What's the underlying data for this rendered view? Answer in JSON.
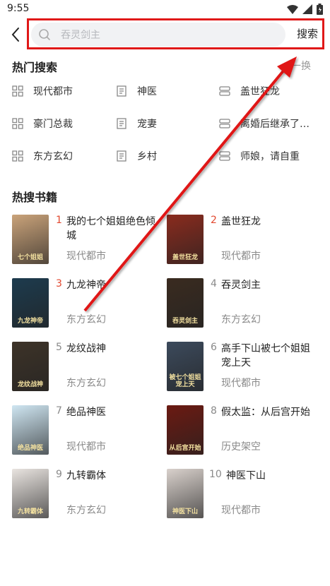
{
  "status_bar": {
    "time": "9:55"
  },
  "search": {
    "placeholder": "吞灵剑主",
    "button_label": "搜索"
  },
  "hot_search": {
    "title": "热门搜索",
    "refresh_label": "一换",
    "tags": [
      "现代都市",
      "神医",
      "盖世狂龙",
      "豪门总裁",
      "宠妻",
      "离婚后继承了…",
      "东方玄幻",
      "乡村",
      "师娘，请自重"
    ]
  },
  "hot_books": {
    "title": "热搜书籍",
    "items": [
      {
        "rank": "1",
        "title": "我的七个姐姐绝色倾城",
        "category": "现代都市",
        "cover_color": "#caa37a",
        "cover_text": "七个姐姐"
      },
      {
        "rank": "2",
        "title": "盖世狂龙",
        "category": "现代都市",
        "cover_color": "#8a2b1e",
        "cover_text": "盖世狂龙"
      },
      {
        "rank": "3",
        "title": "九龙神帝",
        "category": "东方玄幻",
        "cover_color": "#1d3b4e",
        "cover_text": "九龙神帝"
      },
      {
        "rank": "4",
        "title": "吞灵剑主",
        "category": "东方玄幻",
        "cover_color": "#3a2b20",
        "cover_text": "吞灵剑主"
      },
      {
        "rank": "5",
        "title": "龙纹战神",
        "category": "东方玄幻",
        "cover_color": "#3d3328",
        "cover_text": "龙纹战神"
      },
      {
        "rank": "6",
        "title": "高手下山被七个姐姐宠上天",
        "category": "现代都市",
        "cover_color": "#3c4a5c",
        "cover_text": "被七个姐姐宠上天"
      },
      {
        "rank": "7",
        "title": "绝品神医",
        "category": "现代都市",
        "cover_color": "#cfe6f2",
        "cover_text": "绝品神医"
      },
      {
        "rank": "8",
        "title": "假太监：从后宫开始",
        "category": "历史架空",
        "cover_color": "#6b1a12",
        "cover_text": "从后宫开始"
      },
      {
        "rank": "9",
        "title": "九转霸体",
        "category": "东方玄幻",
        "cover_color": "#e9e4e0",
        "cover_text": "九转霸体"
      },
      {
        "rank": "10",
        "title": "神医下山",
        "category": "现代都市",
        "cover_color": "#d9d1cc",
        "cover_text": "神医下山"
      }
    ]
  },
  "colors": {
    "rank_top3": "#e2482f",
    "rank_other": "#8a8a8a",
    "annotation_red": "#e01818"
  },
  "icons": [
    "back-chevron-icon",
    "search-icon",
    "wifi-icon",
    "signal-icon",
    "battery-icon",
    "category-grid-icon",
    "book-icon",
    "storage-icon"
  ]
}
